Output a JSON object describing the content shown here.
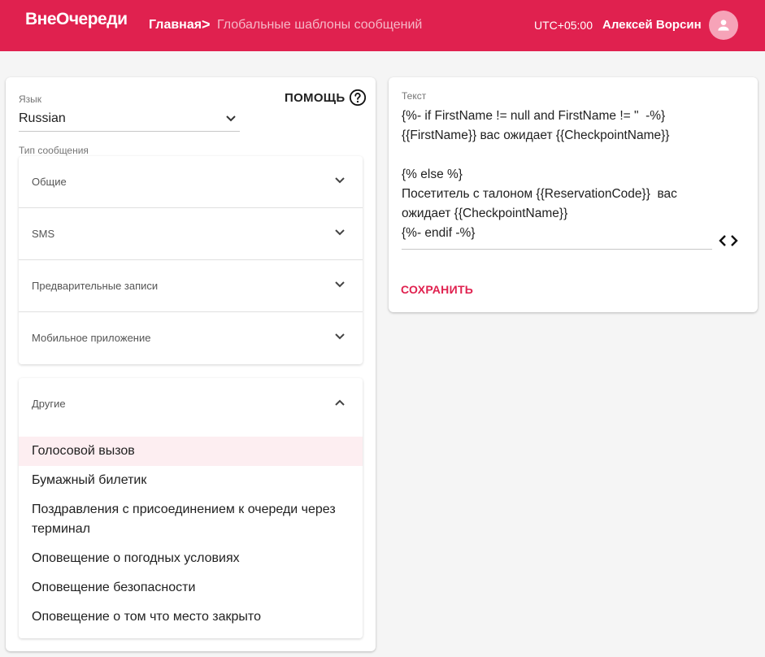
{
  "header": {
    "brand": "ВнеОчереди",
    "breadcrumb_home": "Главная",
    "breadcrumb_separator": ">",
    "breadcrumb_current": "Глобальные шаблоны сообщений",
    "timezone": "UTC+05:00",
    "user_name": "Алексей Ворсин",
    "avatar_icon": "person-icon"
  },
  "colors": {
    "accent": "#e0214f",
    "header_bg": "#e0214f",
    "selected_item_bg": "#fdeef1"
  },
  "left": {
    "language_label": "Язык",
    "language_value": "Russian",
    "help_label": "ПОМОЩЬ",
    "message_type_label": "Тип сообщения",
    "panels": [
      {
        "label": "Общие"
      },
      {
        "label": "SMS"
      },
      {
        "label": "Предварительные записи"
      },
      {
        "label": "Мобильное приложение"
      }
    ],
    "expanded_panel": {
      "label": "Другие",
      "items": [
        {
          "label": "Голосовой вызов",
          "selected": true
        },
        {
          "label": "Бумажный билетик"
        },
        {
          "label": "Поздравления с присоединением к очереди через терминал"
        },
        {
          "label": "Оповещение о погодных условиях"
        },
        {
          "label": "Оповещение безопасности"
        },
        {
          "label": "Оповещение о том что место закрыто"
        }
      ]
    }
  },
  "right": {
    "text_label": "Текст",
    "template_lines": [
      "{%- if FirstName != null and FirstName != \"  -%}",
      "{{FirstName}} вас ожидает {{CheckpointName}}",
      "",
      "{% else %}",
      "Посетитель с талоном {{ReservationCode}}  вас",
      "ожидает {{CheckpointName}}",
      "{%- endif -%}"
    ],
    "save_label": "СОХРАНИТЬ"
  }
}
